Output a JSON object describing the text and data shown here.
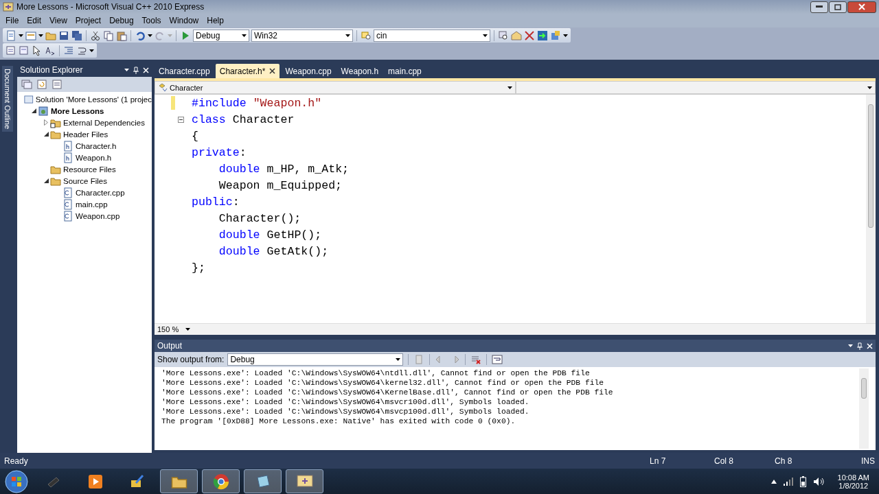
{
  "window": {
    "title": "More Lessons - Microsoft Visual C++ 2010 Express"
  },
  "menu": [
    "File",
    "Edit",
    "View",
    "Project",
    "Debug",
    "Tools",
    "Window",
    "Help"
  ],
  "toolbar": {
    "configuration": "Debug",
    "platform": "Win32",
    "find": "cin"
  },
  "side_tab": "Document Outline",
  "solution_explorer": {
    "title": "Solution Explorer",
    "tree": [
      {
        "label": "Solution 'More Lessons' (1 projec",
        "kind": "solution",
        "children": [
          {
            "label": "More Lessons",
            "kind": "project",
            "expanded": true,
            "children": [
              {
                "label": "External Dependencies",
                "kind": "refs",
                "expanded": false
              },
              {
                "label": "Header Files",
                "kind": "folder",
                "expanded": true,
                "children": [
                  {
                    "label": "Character.h",
                    "kind": "header"
                  },
                  {
                    "label": "Weapon.h",
                    "kind": "header"
                  }
                ]
              },
              {
                "label": "Resource Files",
                "kind": "folder"
              },
              {
                "label": "Source Files",
                "kind": "folder",
                "expanded": true,
                "children": [
                  {
                    "label": "Character.cpp",
                    "kind": "cpp"
                  },
                  {
                    "label": "main.cpp",
                    "kind": "cpp"
                  },
                  {
                    "label": "Weapon.cpp",
                    "kind": "cpp"
                  }
                ]
              }
            ]
          }
        ]
      }
    ]
  },
  "tabs": [
    {
      "label": "Character.cpp",
      "selected": false
    },
    {
      "label": "Character.h*",
      "selected": true
    },
    {
      "label": "Weapon.cpp",
      "selected": false
    },
    {
      "label": "Weapon.h",
      "selected": false
    },
    {
      "label": "main.cpp",
      "selected": false
    }
  ],
  "editor": {
    "scope": "Character",
    "zoom": "150 %",
    "lines": [
      {
        "changed": true,
        "tokens": [
          {
            "kind": "keyword",
            "text": "#include"
          },
          {
            "kind": "string",
            "text": " \"Weapon.h\""
          }
        ]
      },
      {
        "fold": true,
        "tokens": [
          {
            "kind": "keyword",
            "text": "class"
          },
          {
            "kind": "plain",
            "text": " Character"
          }
        ]
      },
      {
        "tokens": [
          {
            "kind": "plain",
            "text": "{"
          }
        ]
      },
      {
        "tokens": [
          {
            "kind": "keyword",
            "text": "private"
          },
          {
            "kind": "plain",
            "text": ":"
          }
        ]
      },
      {
        "tokens": [
          {
            "kind": "keyword",
            "text": "    double"
          },
          {
            "kind": "plain",
            "text": " m_HP, m_Atk;"
          }
        ]
      },
      {
        "tokens": [
          {
            "kind": "plain",
            "text": "    Weapon m_Equipped;"
          }
        ]
      },
      {
        "tokens": [
          {
            "kind": "keyword",
            "text": "public"
          },
          {
            "kind": "plain",
            "text": ":"
          }
        ]
      },
      {
        "tokens": [
          {
            "kind": "plain",
            "text": "    Character();"
          }
        ]
      },
      {
        "tokens": [
          {
            "kind": "keyword",
            "text": "    double"
          },
          {
            "kind": "plain",
            "text": " GetHP();"
          }
        ]
      },
      {
        "tokens": [
          {
            "kind": "keyword",
            "text": "    double"
          },
          {
            "kind": "plain",
            "text": " GetAtk();"
          }
        ]
      },
      {
        "tokens": [
          {
            "kind": "plain",
            "text": "};"
          }
        ]
      }
    ]
  },
  "output": {
    "title": "Output",
    "show_from_label": "Show output from:",
    "source": "Debug",
    "lines": [
      "'More Lessons.exe': Loaded 'C:\\Windows\\SysWOW64\\ntdll.dll', Cannot find or open the PDB file",
      "'More Lessons.exe': Loaded 'C:\\Windows\\SysWOW64\\kernel32.dll', Cannot find or open the PDB file",
      "'More Lessons.exe': Loaded 'C:\\Windows\\SysWOW64\\KernelBase.dll', Cannot find or open the PDB file",
      "'More Lessons.exe': Loaded 'C:\\Windows\\SysWOW64\\msvcr100d.dll', Symbols loaded.",
      "'More Lessons.exe': Loaded 'C:\\Windows\\SysWOW64\\msvcp100d.dll', Symbols loaded.",
      "The program '[0xD88] More Lessons.exe: Native' has exited with code 0 (0x0)."
    ]
  },
  "status_bar": {
    "message": "Ready",
    "line": "Ln 7",
    "column": "Col 8",
    "char": "Ch 8",
    "mode": "INS"
  },
  "taskbar": {
    "time": "10:08 AM",
    "date": "1/8/2012"
  }
}
